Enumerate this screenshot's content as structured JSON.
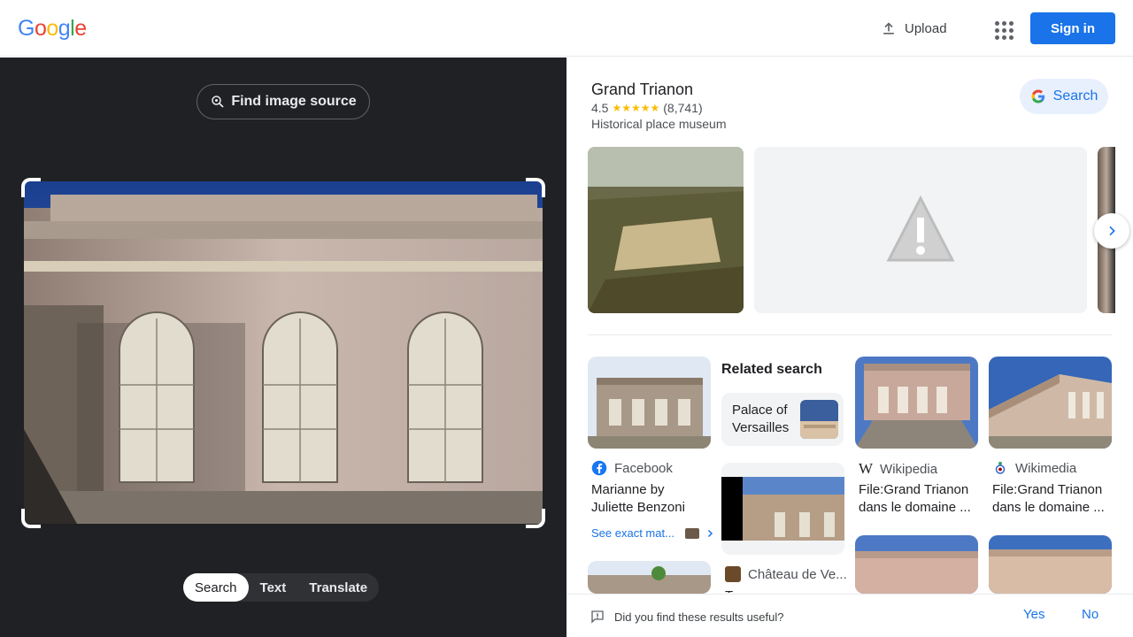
{
  "header": {
    "logo_letters": [
      "G",
      "o",
      "o",
      "g",
      "l",
      "e"
    ],
    "logo_colors": [
      "#4285f4",
      "#ea4335",
      "#fbbc05",
      "#4285f4",
      "#34a853",
      "#ea4335"
    ],
    "upload_label": "Upload",
    "signin_label": "Sign in"
  },
  "left_pane": {
    "find_source_label": "Find image source",
    "modes": [
      "Search",
      "Text",
      "Translate"
    ],
    "active_mode": "Search"
  },
  "knowledge_panel": {
    "title": "Grand Trianon",
    "rating": "4.5",
    "review_count": "(8,741)",
    "type": "Historical place museum",
    "search_label": "Search",
    "stars": "★★★★★"
  },
  "results": {
    "related_search_label": "Related search",
    "related_chip_label": "Palace of Versailles",
    "cards": [
      {
        "source": "Facebook",
        "title": "Marianne by Juliette Benzoni"
      },
      {
        "source": "Wikipedia",
        "title": "File:Grand Trianon dans le domaine ..."
      },
      {
        "source": "Wikimedia",
        "title": "File:Grand Trianon dans le domaine ..."
      },
      {
        "source": "Château de Ve...",
        "title": "T..."
      }
    ],
    "see_exact_label": "See exact mat..."
  },
  "feedback": {
    "question": "Did you find these results useful?",
    "yes_label": "Yes",
    "no_label": "No"
  },
  "colors": {
    "accent": "#1a73e8",
    "dark_bg": "#202124"
  }
}
